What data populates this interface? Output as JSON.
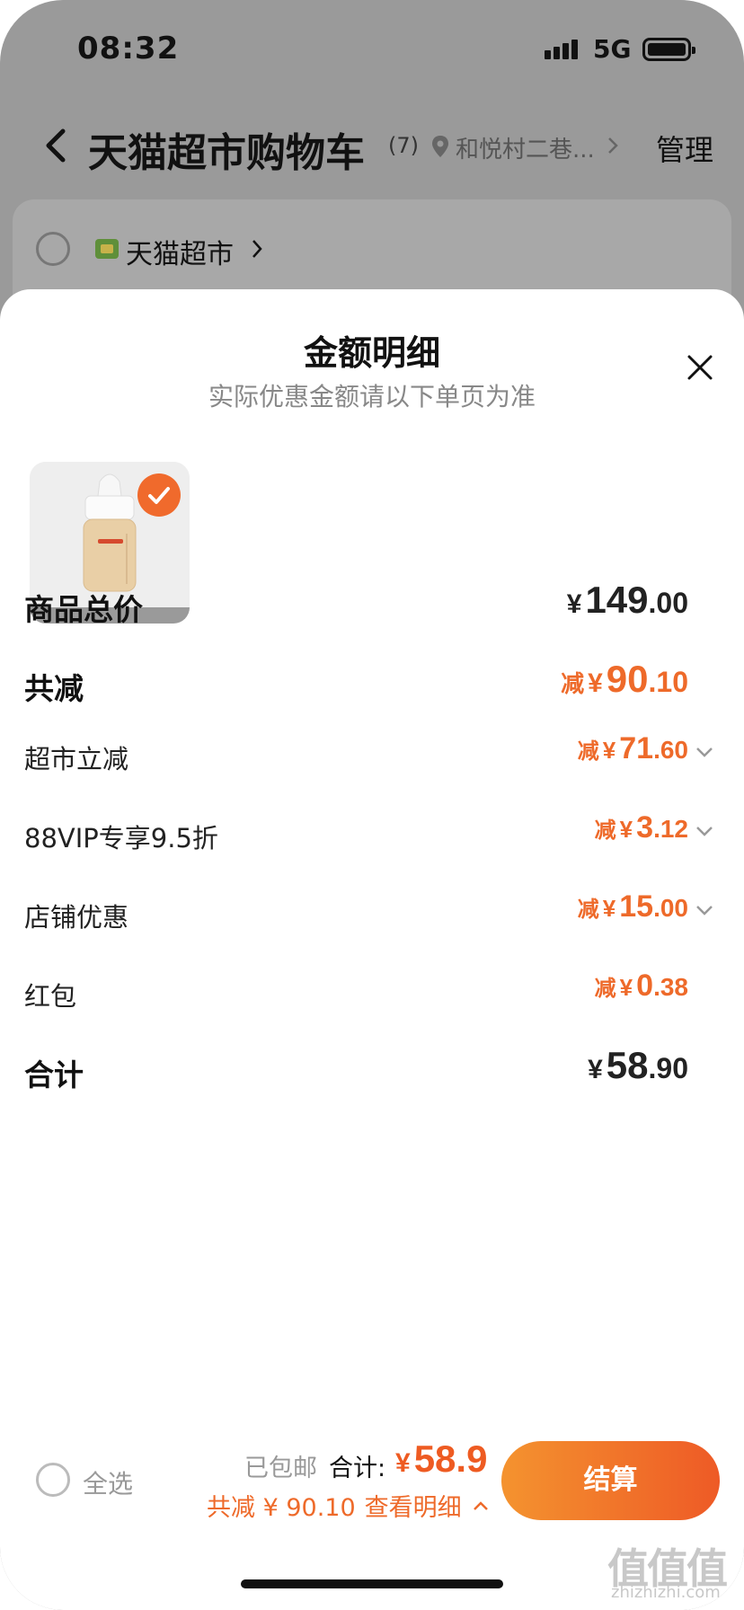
{
  "status_bar": {
    "time": "08:32",
    "network": "5G"
  },
  "header": {
    "title": "天猫超市购物车",
    "count": "(7)",
    "location": "和悦村二巷...",
    "manage": "管理"
  },
  "store": {
    "name": "天猫超市"
  },
  "sheet": {
    "title": "金额明细",
    "subtitle": "实际优惠金额请以下单页为准",
    "product_image": "baby-bottle",
    "rows": [
      {
        "label": "商品总价",
        "prefix": "",
        "yen": "¥",
        "int": "149",
        "dec": ".00",
        "color": "#222222"
      },
      {
        "label": "共减",
        "prefix": "减",
        "yen": "¥",
        "int": "90",
        "dec": ".10",
        "color": "#ee6a2a"
      },
      {
        "label": "超市立减",
        "prefix": "减",
        "yen": "¥",
        "int": "71",
        "dec": ".60",
        "color": "#ee6a2a"
      },
      {
        "label": "88VIP专享9.5折",
        "prefix": "减",
        "yen": "¥",
        "int": "3",
        "dec": ".12",
        "color": "#ee6a2a"
      },
      {
        "label": "店铺优惠",
        "prefix": "减",
        "yen": "¥",
        "int": "15",
        "dec": ".00",
        "color": "#ee6a2a"
      },
      {
        "label": "红包",
        "prefix": "减",
        "yen": "¥",
        "int": "0",
        "dec": ".38",
        "color": "#ee6a2a"
      },
      {
        "label": "合计",
        "prefix": "",
        "yen": "¥",
        "int": "58",
        "dec": ".90",
        "color": "#222222"
      }
    ]
  },
  "bottom_bar": {
    "select_all": "全选",
    "shipping": "已包邮",
    "total_label": "合计:",
    "total_yen": "¥",
    "total_amount": "58.9",
    "discount": "共减 ¥ 90.10",
    "detail_link": "查看明细",
    "checkout": "结算"
  },
  "watermark": {
    "text": "值值值",
    "sub": "zhizhizhi.com"
  },
  "colors": {
    "accent": "#ee6a2a",
    "checkout_start": "#f4932f",
    "checkout_end": "#ee5a26"
  }
}
